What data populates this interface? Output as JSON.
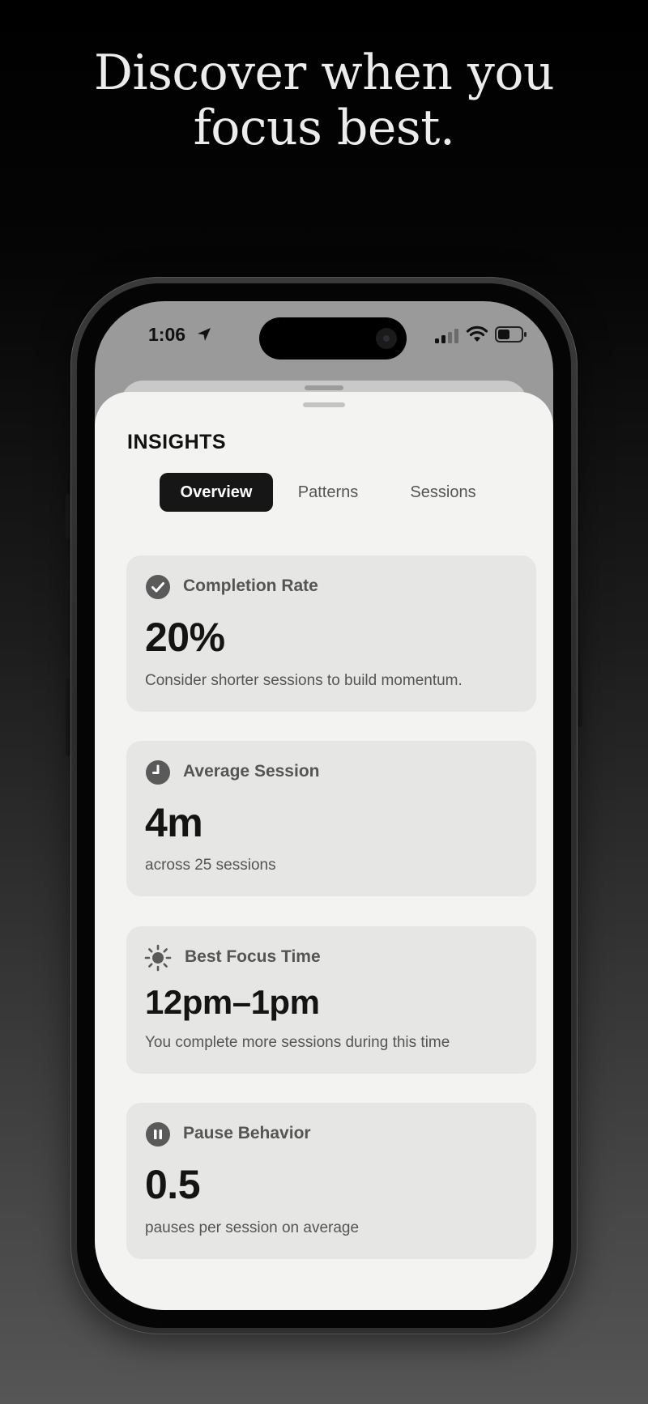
{
  "headline": {
    "line1": "Discover when you",
    "line2": "focus best."
  },
  "status_bar": {
    "time": "1:06"
  },
  "page": {
    "title": "INSIGHTS"
  },
  "tabs": [
    {
      "label": "Overview",
      "selected": true
    },
    {
      "label": "Patterns",
      "selected": false
    },
    {
      "label": "Sessions",
      "selected": false
    }
  ],
  "cards": [
    {
      "icon": "checkmark-circle-icon",
      "label": "Completion Rate",
      "value": "20%",
      "note": "Consider shorter sessions to build momentum."
    },
    {
      "icon": "clock-icon",
      "label": "Average Session",
      "value": "4m",
      "note": "across 25 sessions"
    },
    {
      "icon": "sun-icon",
      "label": "Best Focus Time",
      "value": "12pm–1pm",
      "note": "You complete more sessions during this time"
    },
    {
      "icon": "pause-circle-icon",
      "label": "Pause Behavior",
      "value": "0.5",
      "note": "pauses per session on average"
    }
  ],
  "colors": {
    "accent_dark": "#161616",
    "card_bg": "#e6e6e5",
    "sheet_bg": "#f3f3f2",
    "icon_gray": "#5a5a5a"
  }
}
